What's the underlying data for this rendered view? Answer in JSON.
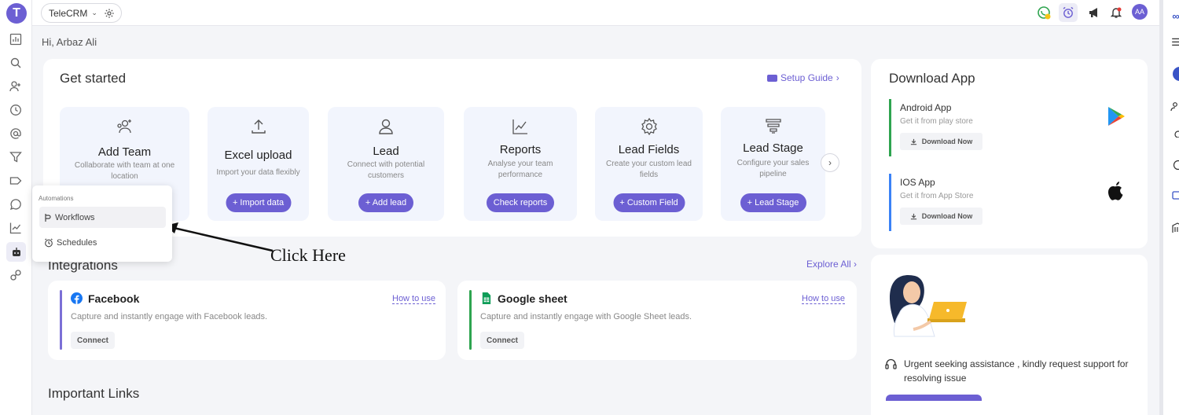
{
  "topbar": {
    "workspace": "TeleCRM",
    "avatar_initials": "AA"
  },
  "greeting": "Hi, Arbaz Ali",
  "get_started": {
    "title": "Get started",
    "setup_guide": "Setup Guide",
    "tiles": [
      {
        "title": "Add Team",
        "desc": "Collaborate with team at one location",
        "button": "",
        "icon": "add-team-icon"
      },
      {
        "title": "Excel upload",
        "desc": "Import your data flexibly",
        "button": "+ Import data",
        "icon": "upload-icon"
      },
      {
        "title": "Lead",
        "desc": "Connect with potential customers",
        "button": "+ Add lead",
        "icon": "user-icon"
      },
      {
        "title": "Reports",
        "desc": "Analyse your team performance",
        "button": "Check reports",
        "icon": "chart-icon"
      },
      {
        "title": "Lead Fields",
        "desc": "Create your custom lead fields",
        "button": "+ Custom Field",
        "icon": "gear-icon"
      },
      {
        "title": "Lead Stage",
        "desc": "Configure your sales pipeline",
        "button": "+ Lead Stage",
        "icon": "funnel-icon"
      }
    ]
  },
  "automations_menu": {
    "header": "Automations",
    "items": [
      {
        "label": "Workflows",
        "selected": true
      },
      {
        "label": "Schedules",
        "selected": false
      }
    ]
  },
  "annotation": {
    "text": "Click Here"
  },
  "integrations": {
    "title": "Integrations",
    "explore_all": "Explore All",
    "cards": [
      {
        "name": "Facebook",
        "how_to_use": "How to use",
        "desc": "Capture and instantly engage with Facebook leads.",
        "connect": "Connect",
        "accent": "#7b6fd6"
      },
      {
        "name": "Google sheet",
        "how_to_use": "How to use",
        "desc": "Capture and instantly engage with Google Sheet leads.",
        "connect": "Connect",
        "accent": "#2ea44f"
      }
    ]
  },
  "important_links": {
    "title": "Important Links"
  },
  "download_app": {
    "title": "Download App",
    "items": [
      {
        "name": "Android App",
        "sub": "Get it from play store",
        "button": "Download Now",
        "accent": "#2ea44f"
      },
      {
        "name": "IOS App",
        "sub": "Get it from App Store",
        "button": "Download Now",
        "accent": "#3b82f6"
      }
    ]
  },
  "support": {
    "text": "Urgent seeking assistance , kindly request support for resolving issue"
  },
  "colors": {
    "brand": "#6c5fd3",
    "tile_bg": "#f2f5fd",
    "page_bg": "#f4f5f8"
  }
}
